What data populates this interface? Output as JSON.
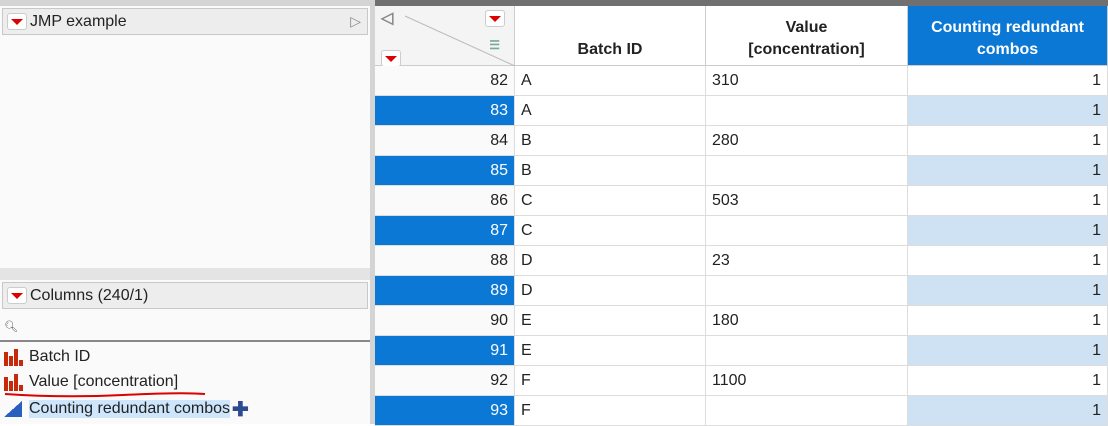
{
  "left_panel": {
    "title": "JMP example",
    "columns_header": "Columns (240/1)",
    "columns": [
      {
        "name": "Batch ID",
        "type": "nominal"
      },
      {
        "name": "Value [concentration]",
        "type": "nominal"
      },
      {
        "name": "Counting redundant combos",
        "type": "continuous"
      }
    ]
  },
  "table": {
    "headers": [
      "Batch ID",
      "Value [concentration]",
      "Counting redundant combos"
    ],
    "rows": [
      {
        "n": "82",
        "batch": "A",
        "value": "310",
        "count": "1",
        "selected": false
      },
      {
        "n": "83",
        "batch": "A",
        "value": "",
        "count": "1",
        "selected": true
      },
      {
        "n": "84",
        "batch": "B",
        "value": "280",
        "count": "1",
        "selected": false
      },
      {
        "n": "85",
        "batch": "B",
        "value": "",
        "count": "1",
        "selected": true
      },
      {
        "n": "86",
        "batch": "C",
        "value": "503",
        "count": "1",
        "selected": false
      },
      {
        "n": "87",
        "batch": "C",
        "value": "",
        "count": "1",
        "selected": true
      },
      {
        "n": "88",
        "batch": "D",
        "value": "23",
        "count": "1",
        "selected": false
      },
      {
        "n": "89",
        "batch": "D",
        "value": "",
        "count": "1",
        "selected": true
      },
      {
        "n": "90",
        "batch": "E",
        "value": "180",
        "count": "1",
        "selected": false
      },
      {
        "n": "91",
        "batch": "E",
        "value": "",
        "count": "1",
        "selected": true
      },
      {
        "n": "92",
        "batch": "F",
        "value": "1100",
        "count": "1",
        "selected": false
      },
      {
        "n": "93",
        "batch": "F",
        "value": "",
        "count": "1",
        "selected": true
      }
    ]
  },
  "colors": {
    "selected": "#0a78d4",
    "selected_col": "#cfe2f3",
    "accent_red": "#d00000"
  }
}
